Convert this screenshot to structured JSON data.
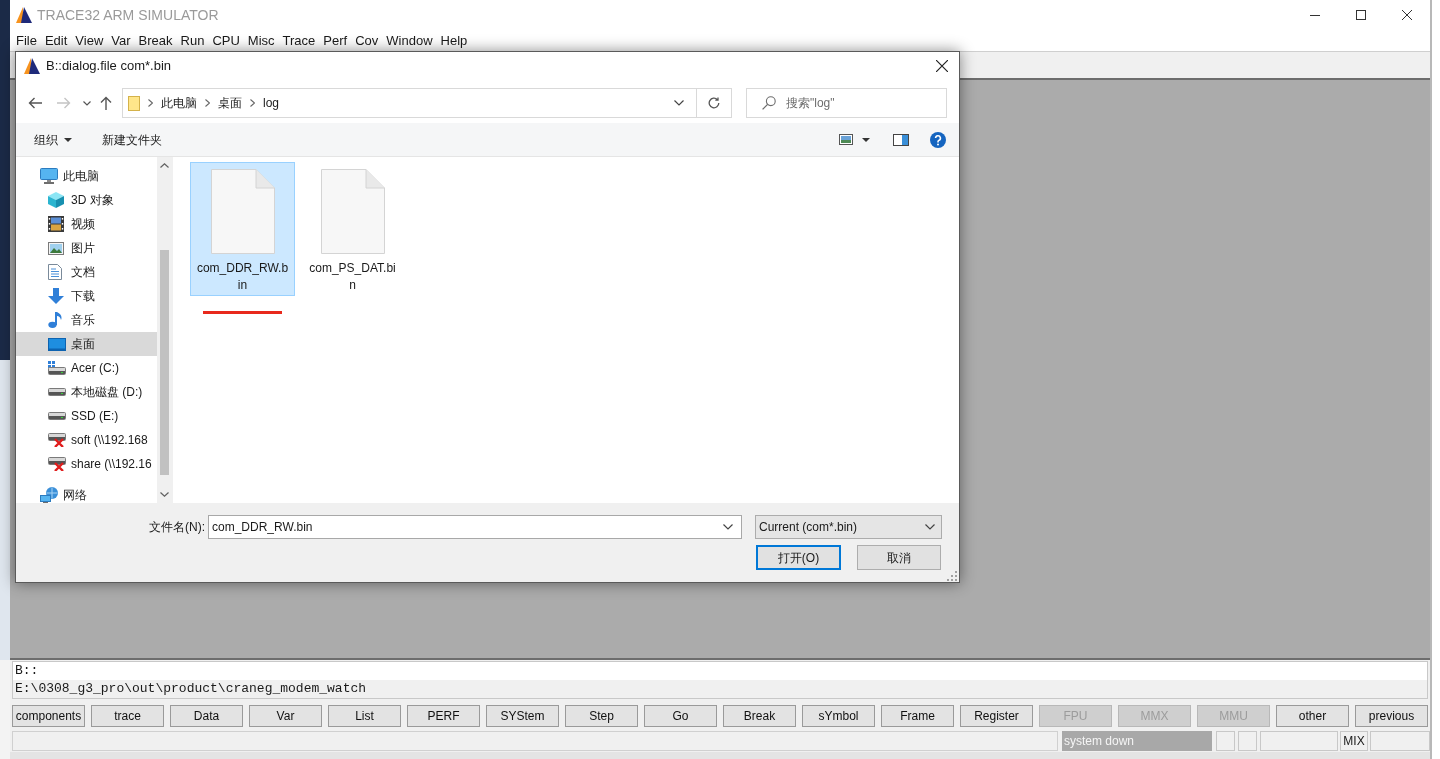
{
  "window": {
    "title": "TRACE32 ARM SIMULATOR"
  },
  "menu": [
    "File",
    "Edit",
    "View",
    "Var",
    "Break",
    "Run",
    "CPU",
    "Misc",
    "Trace",
    "Perf",
    "Cov",
    "Window",
    "Help"
  ],
  "dialog": {
    "title": "B::dialog.file com*.bin",
    "nav_buttons": [
      {
        "kind": "back",
        "disabled": false
      },
      {
        "kind": "forward",
        "disabled": true
      },
      {
        "kind": "recent",
        "disabled": false
      },
      {
        "kind": "up",
        "disabled": false
      }
    ],
    "breadcrumbs": [
      "此电脑",
      "桌面",
      "log"
    ],
    "search": {
      "placeholder": "搜索\"log\""
    },
    "commands": [
      {
        "label": "组织",
        "kind": "menu"
      },
      {
        "label": "新建文件夹",
        "kind": "button"
      }
    ],
    "nav_tree": [
      {
        "label": "此电脑",
        "kind": "computer",
        "selected": false,
        "children": [
          {
            "label": "3D 对象",
            "kind": "cube",
            "selected": false
          },
          {
            "label": "视频",
            "kind": "video",
            "selected": false
          },
          {
            "label": "图片",
            "kind": "picture",
            "selected": false
          },
          {
            "label": "文档",
            "kind": "document",
            "selected": false
          },
          {
            "label": "下载",
            "kind": "download",
            "selected": false
          },
          {
            "label": "音乐",
            "kind": "music",
            "selected": false
          },
          {
            "label": "桌面",
            "kind": "desktop",
            "selected": true
          },
          {
            "label": "Acer (C:)",
            "kind": "systemdrive",
            "selected": false
          },
          {
            "label": "本地磁盘 (D:)",
            "kind": "drive",
            "selected": false
          },
          {
            "label": "SSD (E:)",
            "kind": "drive",
            "selected": false
          },
          {
            "label": "soft (\\\\192.168",
            "kind": "netdrive",
            "selected": false
          },
          {
            "label": "share (\\\\192.16",
            "kind": "netdrive",
            "selected": false
          }
        ]
      },
      {
        "label": "网络",
        "kind": "network",
        "selected": false
      }
    ],
    "files": [
      {
        "name": "com_DDR_RW.bin",
        "selected": true,
        "annotated": true
      },
      {
        "name": "com_PS_DAT.bin",
        "selected": false,
        "annotated": false
      }
    ],
    "filename": {
      "label": "文件名(N):",
      "value": "com_DDR_RW.bin"
    },
    "filter": {
      "value": "Current (com*.bin)"
    },
    "buttons": [
      {
        "label": "打开(O)",
        "default": true
      },
      {
        "label": "取消",
        "default": false
      }
    ]
  },
  "command_line": {
    "input": "B::",
    "message": "E:\\0308_g3_pro\\out\\product\\craneg_modem_watch"
  },
  "softkeys": [
    {
      "label": "components",
      "disabled": false
    },
    {
      "label": "trace",
      "disabled": false
    },
    {
      "label": "Data",
      "disabled": false
    },
    {
      "label": "Var",
      "disabled": false
    },
    {
      "label": "List",
      "disabled": false
    },
    {
      "label": "PERF",
      "disabled": false
    },
    {
      "label": "SYStem",
      "disabled": false
    },
    {
      "label": "Step",
      "disabled": false
    },
    {
      "label": "Go",
      "disabled": false
    },
    {
      "label": "Break",
      "disabled": false
    },
    {
      "label": "sYmbol",
      "disabled": false
    },
    {
      "label": "Frame",
      "disabled": false
    },
    {
      "label": "Register",
      "disabled": false
    },
    {
      "label": "FPU",
      "disabled": true
    },
    {
      "label": "MMX",
      "disabled": true
    },
    {
      "label": "MMU",
      "disabled": true
    },
    {
      "label": "other",
      "disabled": false
    },
    {
      "label": "previous",
      "disabled": false
    }
  ],
  "status_bar": {
    "state": "system down",
    "mode": "MIX"
  }
}
